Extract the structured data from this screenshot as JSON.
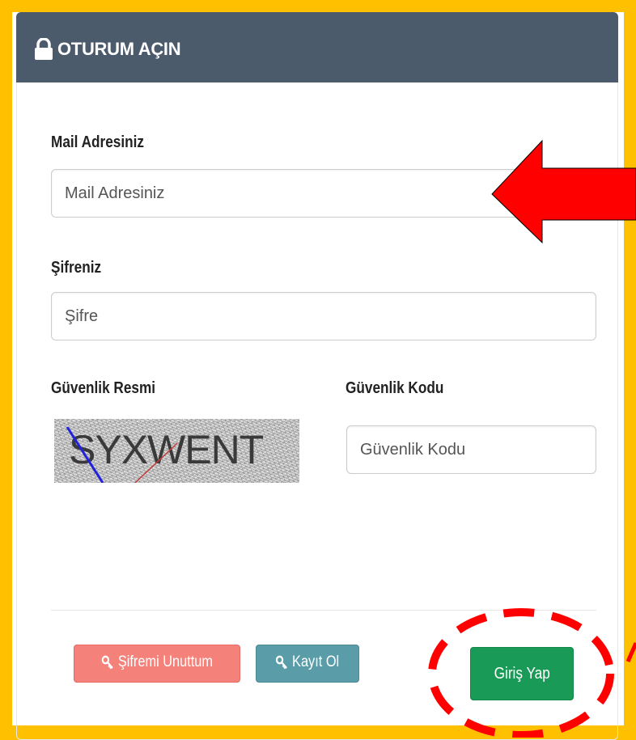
{
  "panel": {
    "title": "OTURUM AÇIN",
    "heading_color": "#4b5b6c"
  },
  "email": {
    "label": "Mail Adresiniz",
    "placeholder": "Mail Adresiniz",
    "value": ""
  },
  "password": {
    "label": "Şifreniz",
    "placeholder": "Şifre",
    "value": ""
  },
  "captcha": {
    "label": "Güvenlik Resmi",
    "image_text": "SYXWENT"
  },
  "security_code": {
    "label": "Güvenlik Kodu",
    "placeholder": "Güvenlik Kodu",
    "value": ""
  },
  "actions": {
    "forgot_password": "Şifremi Unuttum",
    "register": "Kayıt Ol",
    "login": "Giriş Yap",
    "forgot_icon": "key-icon",
    "register_icon": "key-icon"
  },
  "colors": {
    "frame": "#ffc000",
    "forgot_button": "#f4827a",
    "register_button": "#5a9da8",
    "login_button": "#1a9a57",
    "annotation": "#ff0000"
  },
  "annotations": [
    "red-arrow-pointing-at-email-field",
    "red-dashed-circle-around-login-button"
  ]
}
